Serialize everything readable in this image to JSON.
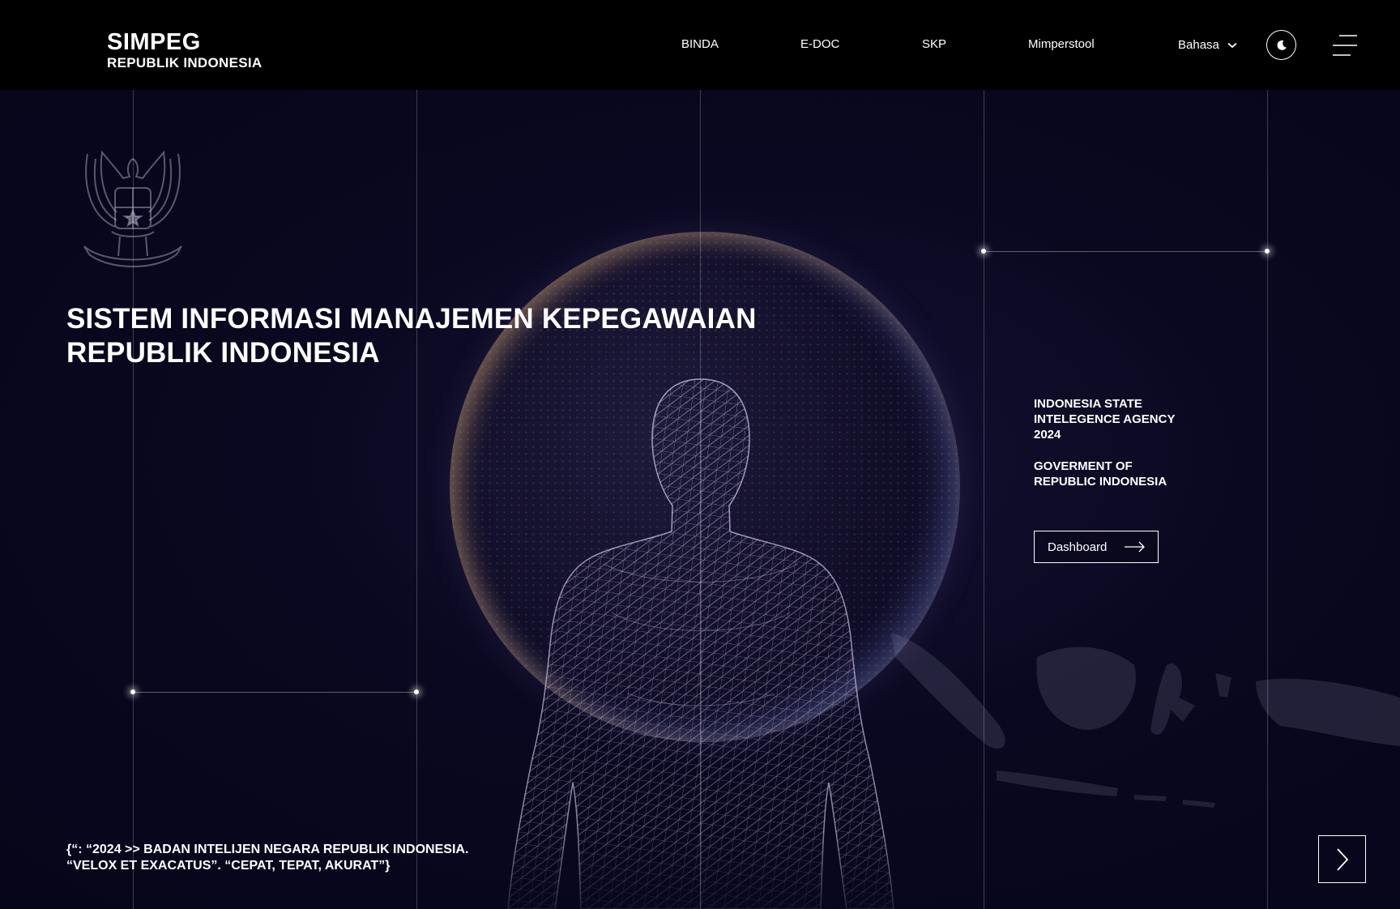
{
  "header": {
    "brand_title": "SIMPEG",
    "brand_subtitle": "REPUBLIK INDONESIA",
    "nav": [
      {
        "label": "BINDA"
      },
      {
        "label": "E-DOC"
      },
      {
        "label": "SKP"
      },
      {
        "label": "Mimperstool"
      }
    ],
    "language_label": "Bahasa",
    "icons": {
      "language": "chevron-down-icon",
      "theme": "moon-icon",
      "menu": "hamburger-menu-icon"
    }
  },
  "hero": {
    "title_line1": "SISTEM INFORMASI MANAJEMEN KEPEGAWAIAN",
    "title_line2": "REPUBLIK INDONESIA",
    "agency_lines": [
      "INDONESIA STATE",
      "INTELEGENCE AGENCY",
      "2024"
    ],
    "gov_lines": [
      "GOVERMENT OF",
      "REPUBLIC INDONESIA"
    ],
    "dashboard_label": "Dashboard",
    "quote_line1": "{“: “2024 >> BADAN INTELIJEN NEGARA REPUBLIK INDONESIA.",
    "quote_line2": "“VELOX ET EXACATUS”. “CEPAT, TEPAT, AKURAT”}",
    "icons": {
      "emblem": "garuda-emblem-icon",
      "dashboard": "arrow-right-icon",
      "next": "chevron-right-icon"
    }
  },
  "colors": {
    "background": "#080616",
    "header": "#000000",
    "text": "#ffffff",
    "globe_glow": "#e6b46e"
  }
}
